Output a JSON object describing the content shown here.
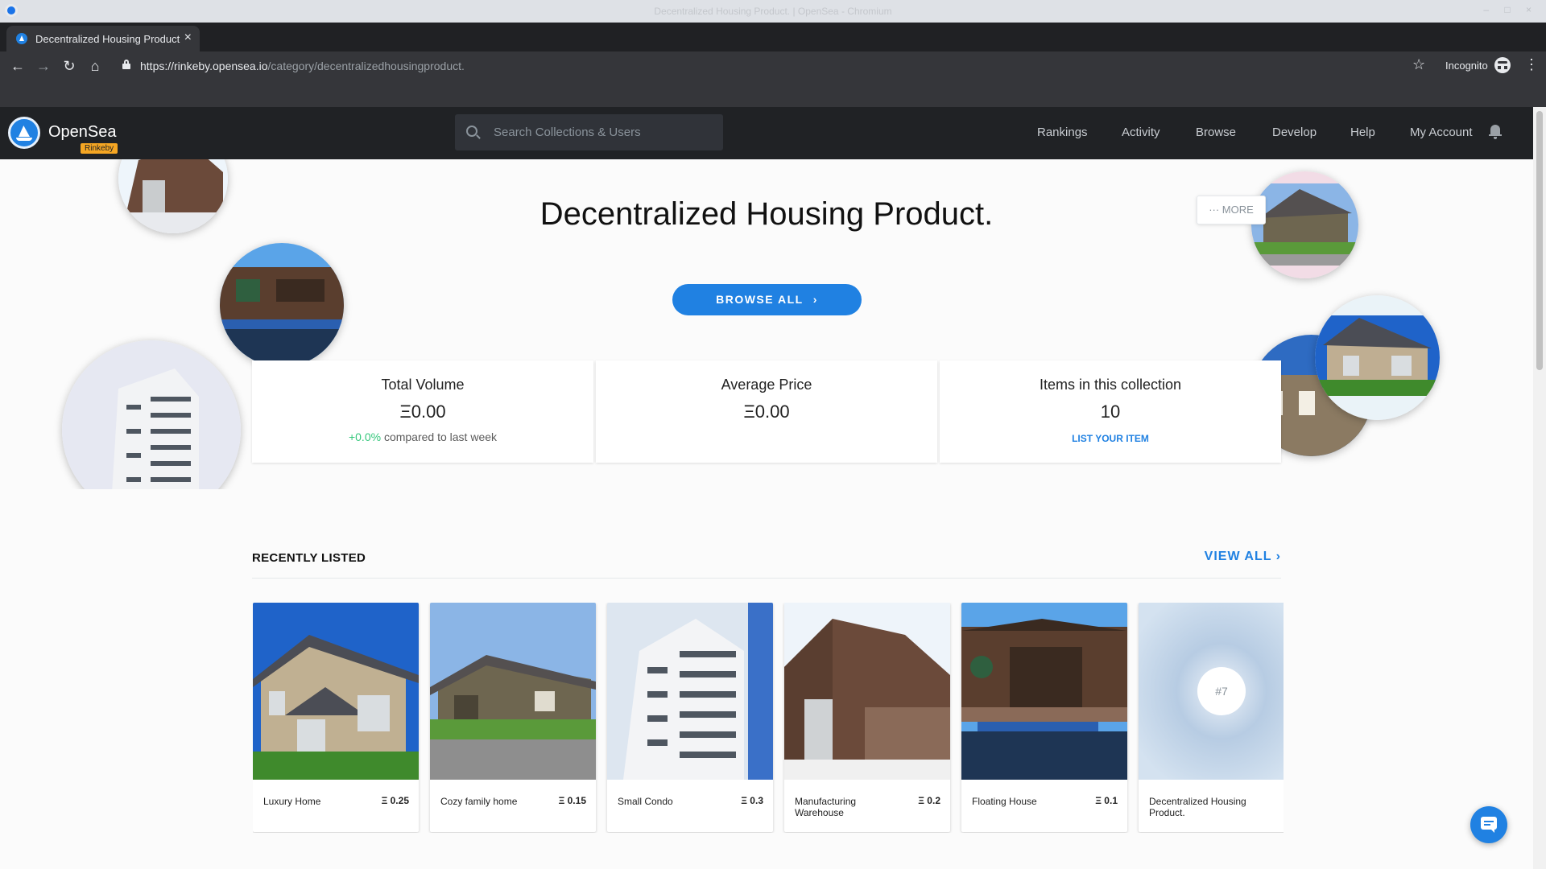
{
  "window": {
    "title": "Decentralized Housing Product. | OpenSea - Chromium"
  },
  "tab": {
    "title": "Decentralized Housing Product.",
    "close": "×",
    "new": "+"
  },
  "address_bar": {
    "host": "https://rinkeby.opensea.io",
    "path": "/category/decentralizedhousingproduct."
  },
  "browser": {
    "incognito_label": "Incognito"
  },
  "nav": {
    "brand": "OpenSea",
    "network_badge": "Rinkeby",
    "search_placeholder": "Search Collections & Users",
    "links": [
      "Rankings",
      "Activity",
      "Browse",
      "Develop",
      "Help",
      "My Account"
    ]
  },
  "hero": {
    "title": "Decentralized Housing Product.",
    "more_label": "··· MORE",
    "browse_all_label": "BROWSE ALL"
  },
  "stats": {
    "total_volume": {
      "label": "Total Volume",
      "value": "Ξ0.00",
      "change": "+0.0%",
      "change_suffix": " compared to last week"
    },
    "average_price": {
      "label": "Average Price",
      "value": "Ξ0.00"
    },
    "items": {
      "label": "Items in this collection",
      "value": "10",
      "link": "LIST YOUR ITEM"
    }
  },
  "recently_listed": {
    "title": "RECENTLY LISTED",
    "view_all": "VIEW ALL",
    "items": [
      {
        "name": "Luxury Home",
        "price": "Ξ 0.25"
      },
      {
        "name": "Cozy family home",
        "price": "Ξ 0.15"
      },
      {
        "name": "Small Condo",
        "price": "Ξ 0.3"
      },
      {
        "name": "Manufacturing Warehouse",
        "price": "Ξ 0.2"
      },
      {
        "name": "Floating House",
        "price": "Ξ 0.1"
      },
      {
        "name": "Decentralized Housing Product.",
        "price": "",
        "placeholder": "#7"
      }
    ]
  },
  "colors": {
    "accent": "#2081e2",
    "nav_bg": "#202225",
    "positive": "#34c77b",
    "badge": "#f5a623"
  }
}
